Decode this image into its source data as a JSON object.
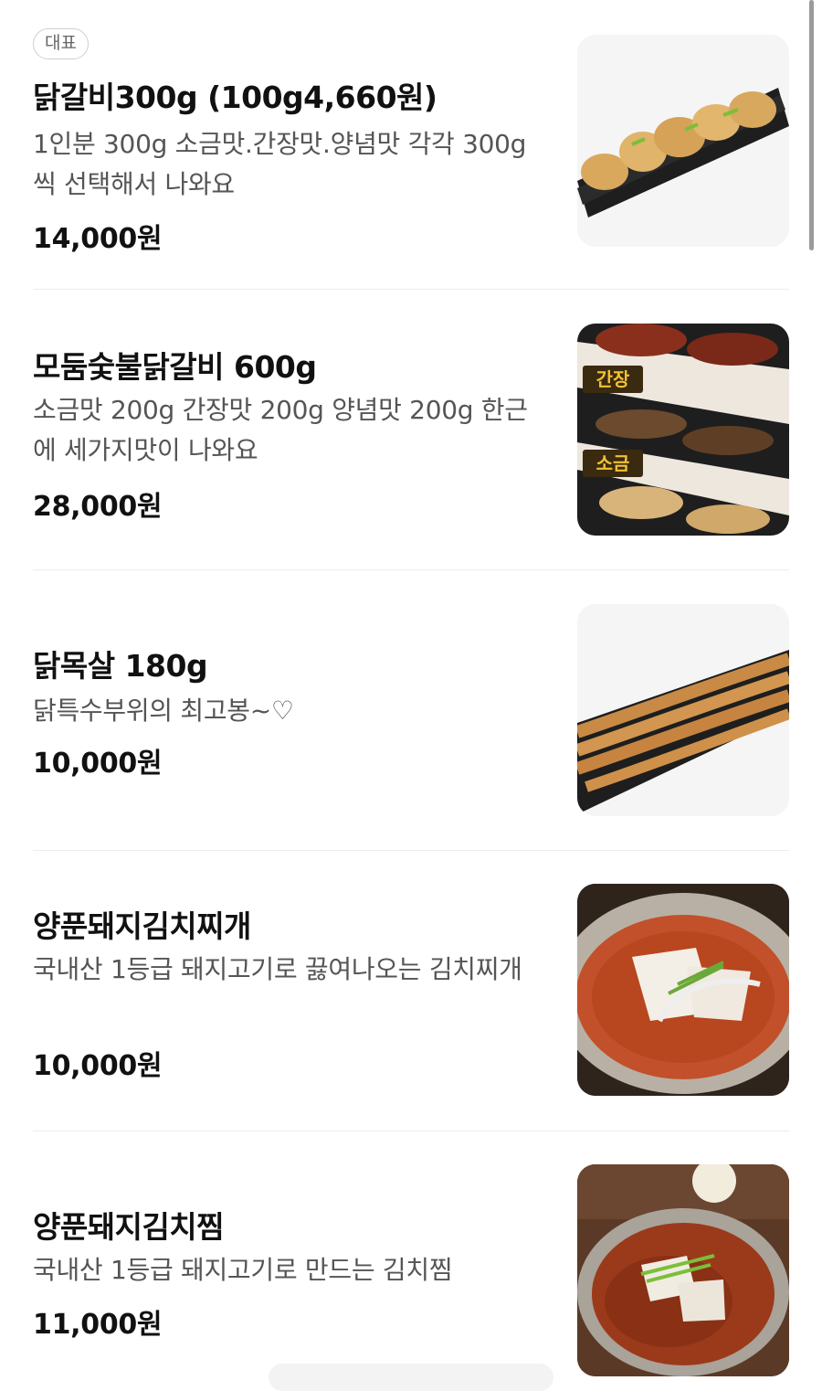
{
  "menu": {
    "items": [
      {
        "badge": "대표",
        "name": "닭갈비300g (100g4,660원)",
        "description": "1인분 300g 소금맛.간장맛.양념맛 각각 300g씩 선택해서 나와요",
        "price": "14,000원",
        "image": "grilled-chicken-galbi-photo"
      },
      {
        "name": "모둠숯불닭갈비 600g",
        "description": "소금맛 200g 간장맛 200g 양념맛 200g 한근에 세가지맛이 나와요",
        "price": "28,000원",
        "image": "assorted-chicken-galbi-photo",
        "image_labels": [
          "간장",
          "소금"
        ]
      },
      {
        "name": "닭목살 180g",
        "description": "닭특수부위의 최고봉~♡",
        "price": "10,000원",
        "image": "chicken-neck-photo"
      },
      {
        "name": "양푼돼지김치찌개",
        "description": "국내산 1등급 돼지고기로 끓여나오는 김치찌개",
        "price": "10,000원",
        "image": "kimchi-stew-photo"
      },
      {
        "name": "양푼돼지김치찜",
        "description": "국내산 1등급 돼지고기로 만드는 김치찜",
        "price": "11,000원",
        "image": "braised-kimchi-photo"
      }
    ]
  },
  "colors": {
    "text": "#111111",
    "description": "#555555",
    "divider": "#ececec",
    "label_bg": "#3a2a10",
    "label_text": "#f1c232"
  }
}
